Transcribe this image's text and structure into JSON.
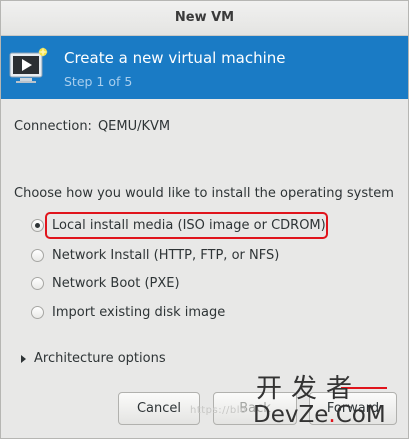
{
  "window": {
    "title": "New VM"
  },
  "banner": {
    "icon": "vm-monitor-icon",
    "title": "Create a new virtual machine",
    "step": "Step 1 of 5"
  },
  "connection": {
    "label": "Connection:",
    "value": "QEMU/KVM"
  },
  "install": {
    "prompt": "Choose how you would like to install the operating system",
    "options": [
      {
        "label": "Local install media (ISO image or CDROM)",
        "selected": true
      },
      {
        "label": "Network Install (HTTP, FTP, or NFS)",
        "selected": false
      },
      {
        "label": "Network Boot (PXE)",
        "selected": false
      },
      {
        "label": "Import existing disk image",
        "selected": false
      }
    ]
  },
  "architecture": {
    "label": "Architecture options",
    "expanded": false
  },
  "buttons": {
    "cancel": "Cancel",
    "back": "Back",
    "forward": "Forward"
  },
  "watermark": {
    "url": "https://blo",
    "brand_top": "开发者",
    "brand_bottom_pre": "DevZe",
    "brand_dot": ".",
    "brand_bottom_post": "CoM"
  },
  "colors": {
    "banner": "#1a7bc5",
    "highlight": "#e0141c"
  }
}
